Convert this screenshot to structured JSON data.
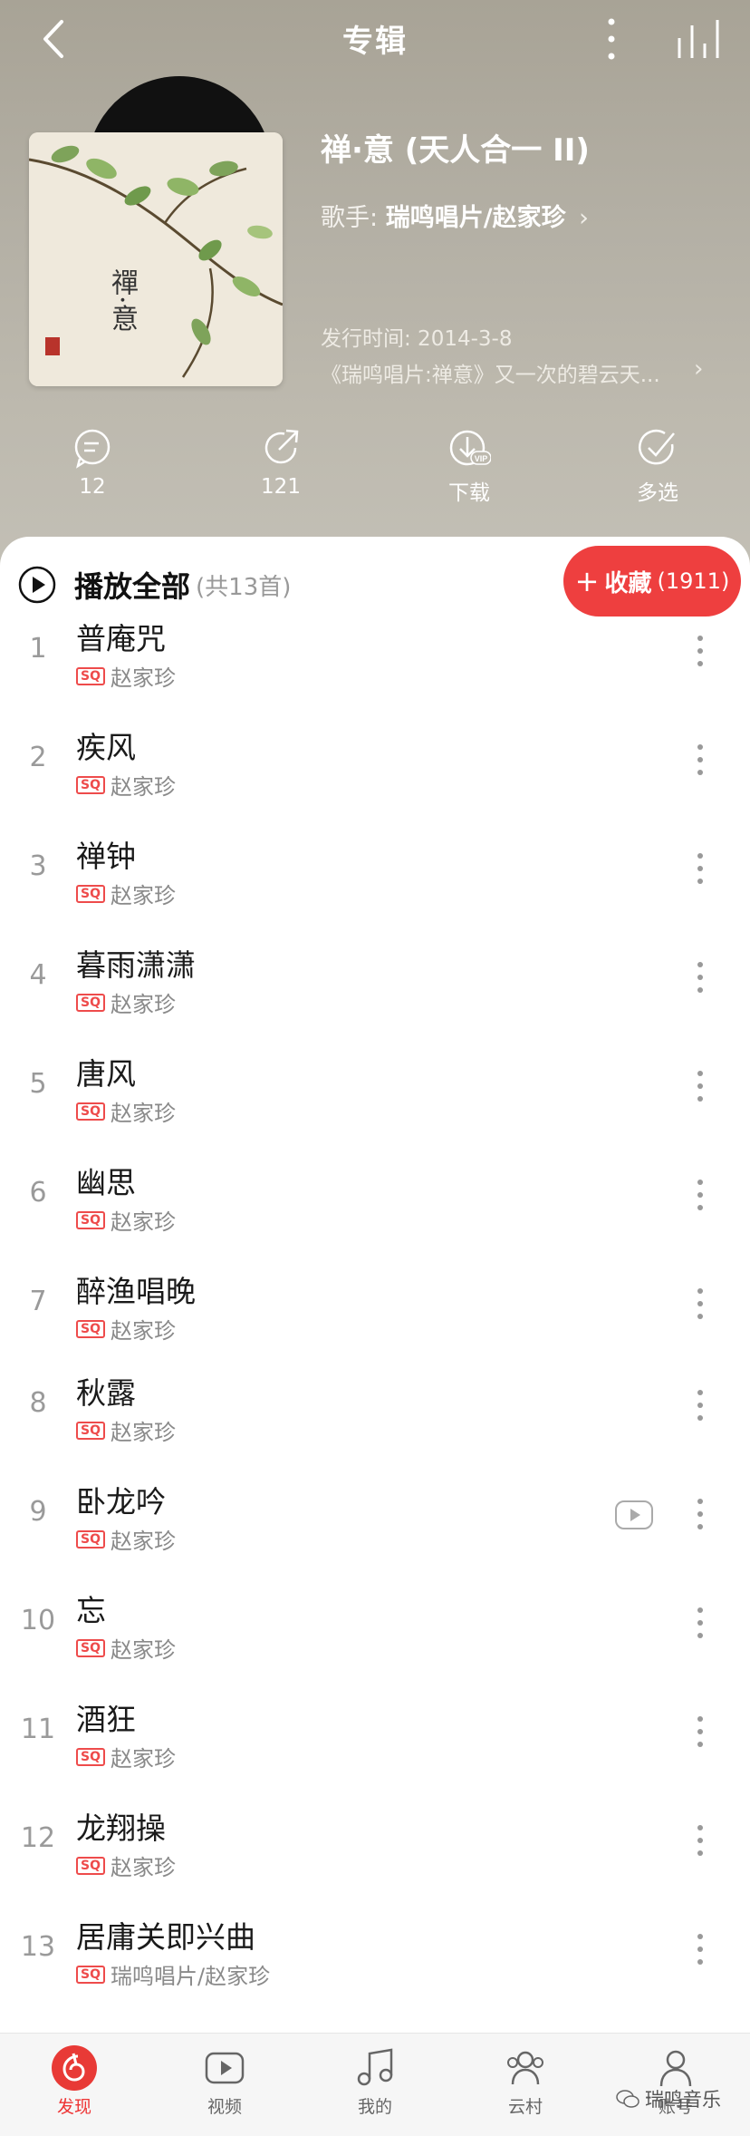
{
  "topbar": {
    "title": "专辑"
  },
  "album": {
    "title": "禅·意 (天人合一 II)",
    "artist_label": "歌手:",
    "artist_name": "瑞鸣唱片/赵家珍",
    "release_date": "发行时间: 2014-3-8",
    "description": "《瑞鸣唱片:禅意》又一次的碧云天...",
    "cover_text": "禪·意"
  },
  "actions": {
    "comments": "12",
    "share": "121",
    "download": "下载",
    "multi_select": "多选"
  },
  "list": {
    "play_all": "播放全部",
    "count": "(共13首)",
    "collect_label": "收藏",
    "collect_count": "(1911)",
    "quality_badge": "SQ",
    "tracks": [
      {
        "num": "1",
        "title": "普庵咒",
        "artist": "赵家珍"
      },
      {
        "num": "2",
        "title": "疾风",
        "artist": "赵家珍"
      },
      {
        "num": "3",
        "title": "禅钟",
        "artist": "赵家珍"
      },
      {
        "num": "4",
        "title": "暮雨潇潇",
        "artist": "赵家珍"
      },
      {
        "num": "5",
        "title": "唐风",
        "artist": "赵家珍"
      },
      {
        "num": "6",
        "title": "幽思",
        "artist": "赵家珍"
      },
      {
        "num": "7",
        "title": "醉渔唱晚",
        "artist": "赵家珍"
      },
      {
        "num": "8",
        "title": "秋露",
        "artist": "赵家珍"
      },
      {
        "num": "9",
        "title": "卧龙吟",
        "artist": "赵家珍"
      },
      {
        "num": "10",
        "title": "忘",
        "artist": "赵家珍"
      },
      {
        "num": "11",
        "title": "酒狂",
        "artist": "赵家珍"
      },
      {
        "num": "12",
        "title": "龙翔操",
        "artist": "赵家珍"
      },
      {
        "num": "13",
        "title": "居庸关即兴曲",
        "artist": "瑞鸣唱片/赵家珍"
      }
    ]
  },
  "nav": {
    "discover": "发现",
    "video": "视频",
    "mine": "我的",
    "cloud_village": "云村",
    "account": "账号"
  },
  "watermark": "瑞鸣音乐",
  "colors": {
    "accent": "#ee3f3f",
    "header_bg": "#b4b0a5"
  }
}
